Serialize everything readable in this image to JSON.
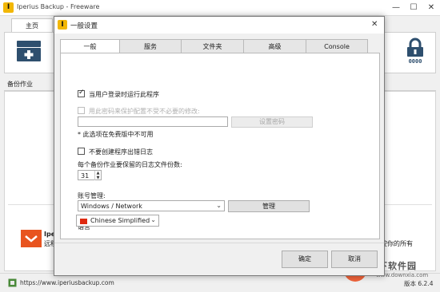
{
  "app": {
    "title": "Iperius Backup - Freeware",
    "logo_char": "I",
    "window_controls": [
      "—",
      "☐",
      "✕"
    ]
  },
  "main": {
    "tab_home": "主页",
    "section_title": "备份作业",
    "promo_title": "Ipe",
    "promo_text": "远程",
    "promo_right": "控你的所有",
    "status_url": "https://www.iperiusbackup.com",
    "version": "版本 6.2.4"
  },
  "dialog": {
    "title": "一般设置",
    "close": "✕",
    "tabs": [
      {
        "label": "一般",
        "active": true
      },
      {
        "label": "服务",
        "active": false
      },
      {
        "label": "文件夹",
        "active": false
      },
      {
        "label": "高级",
        "active": false
      },
      {
        "label": "Console",
        "active": false
      }
    ],
    "run_at_login_label": "当用户登录时运行此程序",
    "run_at_login_checked": true,
    "password_protect_label": "用此密码来保护配置不受不必要的修改:",
    "password_protect_checked": false,
    "set_password_button": "设置密码",
    "free_version_note": "* 此选项在免费版中不可用",
    "no_error_log_label": "不要创建程序出错日志",
    "no_error_log_checked": false,
    "log_retention_label": "每个备份作业要保留的日志文件份数:",
    "log_retention_value": "31",
    "account_label": "账号管理:",
    "account_value": "Windows / Network",
    "manage_button": "管理",
    "language_label": "语言",
    "language_value": "Chinese Simplified",
    "ok_button": "确定",
    "cancel_button": "取消"
  },
  "watermark": {
    "text": "当下软件园",
    "url": "www.downxia.com"
  },
  "colors": {
    "logo": "#f2b705",
    "watermark": "#f04a1a",
    "flag": "#de2910"
  }
}
